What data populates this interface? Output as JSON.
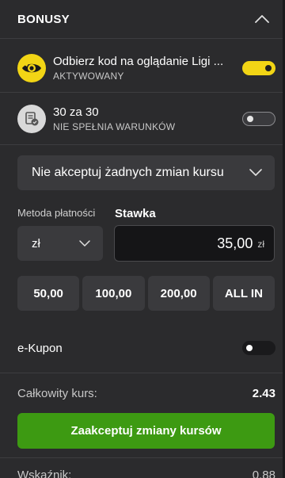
{
  "header": {
    "title": "BONUSY"
  },
  "bonuses": [
    {
      "title": "Odbierz kod na oglądanie Ligi ...",
      "status": "AKTYWOWANY",
      "icon": "eye-icon",
      "enabled": true
    },
    {
      "title": "30 za 30",
      "status": "NIE SPEŁNIA WARUNKÓW",
      "icon": "document-badge-icon",
      "enabled": false
    }
  ],
  "odds_change": {
    "selected": "Nie akceptuj żadnych zmian kursu"
  },
  "payment": {
    "label": "Metoda płatności",
    "currency": "zł"
  },
  "stake": {
    "label": "Stawka",
    "value": "35,00",
    "unit": "zł"
  },
  "quick_stakes": [
    "50,00",
    "100,00",
    "200,00",
    "ALL IN"
  ],
  "ecoupon": {
    "label": "e-Kupon",
    "enabled": false
  },
  "total": {
    "label": "Całkowity kurs:",
    "value": "2.43"
  },
  "accept_button": {
    "label": "Zaakceptuj zmiany kursów"
  },
  "indicator": {
    "label": "Wskaźnik:",
    "value": "0.88"
  },
  "colors": {
    "background": "#2b2b2d",
    "accent_yellow": "#f2d515",
    "accept_green": "#3d9a12",
    "input_bg": "#151517"
  }
}
